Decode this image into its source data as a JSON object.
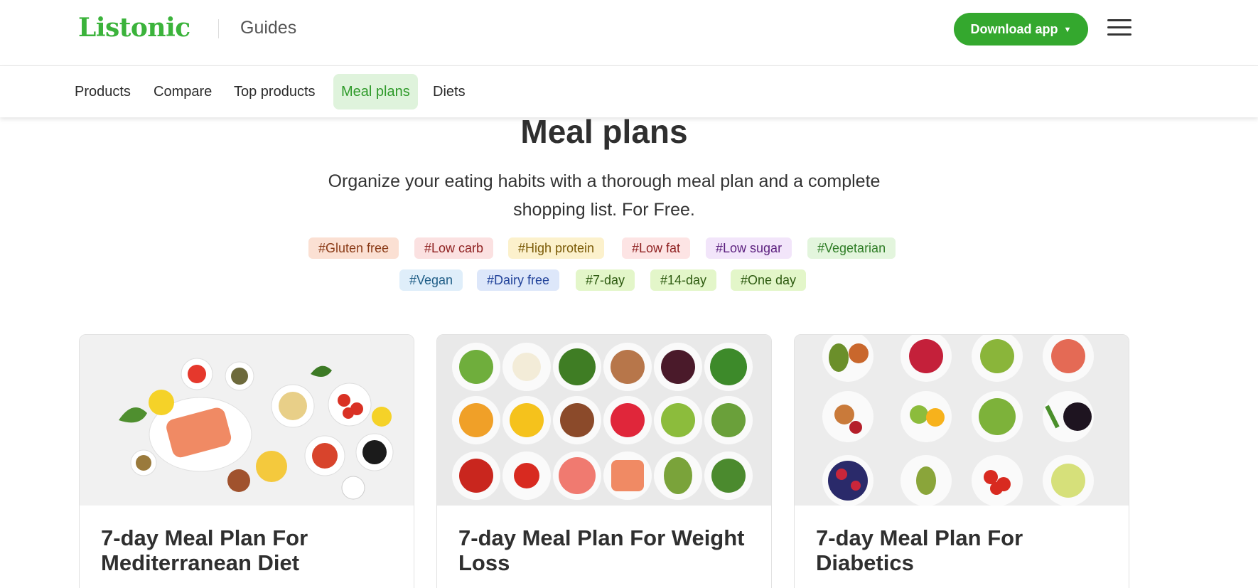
{
  "header": {
    "logo": "Listonic",
    "section": "Guides",
    "download_label": "Download app",
    "download_icon": "chevron-down-icon",
    "menu_icon": "hamburger-menu-icon",
    "brand_color": "#34a82e"
  },
  "nav": {
    "items": [
      {
        "label": "Products",
        "active": false
      },
      {
        "label": "Compare",
        "active": false
      },
      {
        "label": "Top products",
        "active": false
      },
      {
        "label": "Meal plans",
        "active": true
      },
      {
        "label": "Diets",
        "active": false
      }
    ]
  },
  "hero": {
    "title": "Meal plans",
    "subtitle": "Organize your eating habits with a thorough meal plan and a complete shopping list. For Free."
  },
  "tags": [
    {
      "label": "#Gluten free",
      "bg": "#fbe0d3",
      "fg": "#8a3a16"
    },
    {
      "label": "#Low carb",
      "bg": "#fbe1e1",
      "fg": "#8f2121"
    },
    {
      "label": "#High protein",
      "bg": "#fcf1cc",
      "fg": "#7a5a06"
    },
    {
      "label": "#Low fat",
      "bg": "#fde4e4",
      "fg": "#8f2121"
    },
    {
      "label": "#Low sugar",
      "bg": "#f2e5fa",
      "fg": "#5b1f7e"
    },
    {
      "label": "#Vegetarian",
      "bg": "#e3f5dd",
      "fg": "#2f7d26"
    },
    {
      "label": "#Vegan",
      "bg": "#dfeefa",
      "fg": "#1f5d86"
    },
    {
      "label": "#Dairy free",
      "bg": "#dde7fa",
      "fg": "#22439a"
    },
    {
      "label": "#7-day",
      "bg": "#e3f6c9",
      "fg": "#2d5a10"
    },
    {
      "label": "#14-day",
      "bg": "#e3f6c9",
      "fg": "#2d5a10"
    },
    {
      "label": "#One day",
      "bg": "#e3f6c9",
      "fg": "#2d5a10"
    }
  ],
  "cards": [
    {
      "title": "7-day Meal Plan For Mediterranean Diet"
    },
    {
      "title": "7-day Meal Plan For Weight Loss"
    },
    {
      "title": "7-day Meal Plan For Diabetics"
    }
  ]
}
